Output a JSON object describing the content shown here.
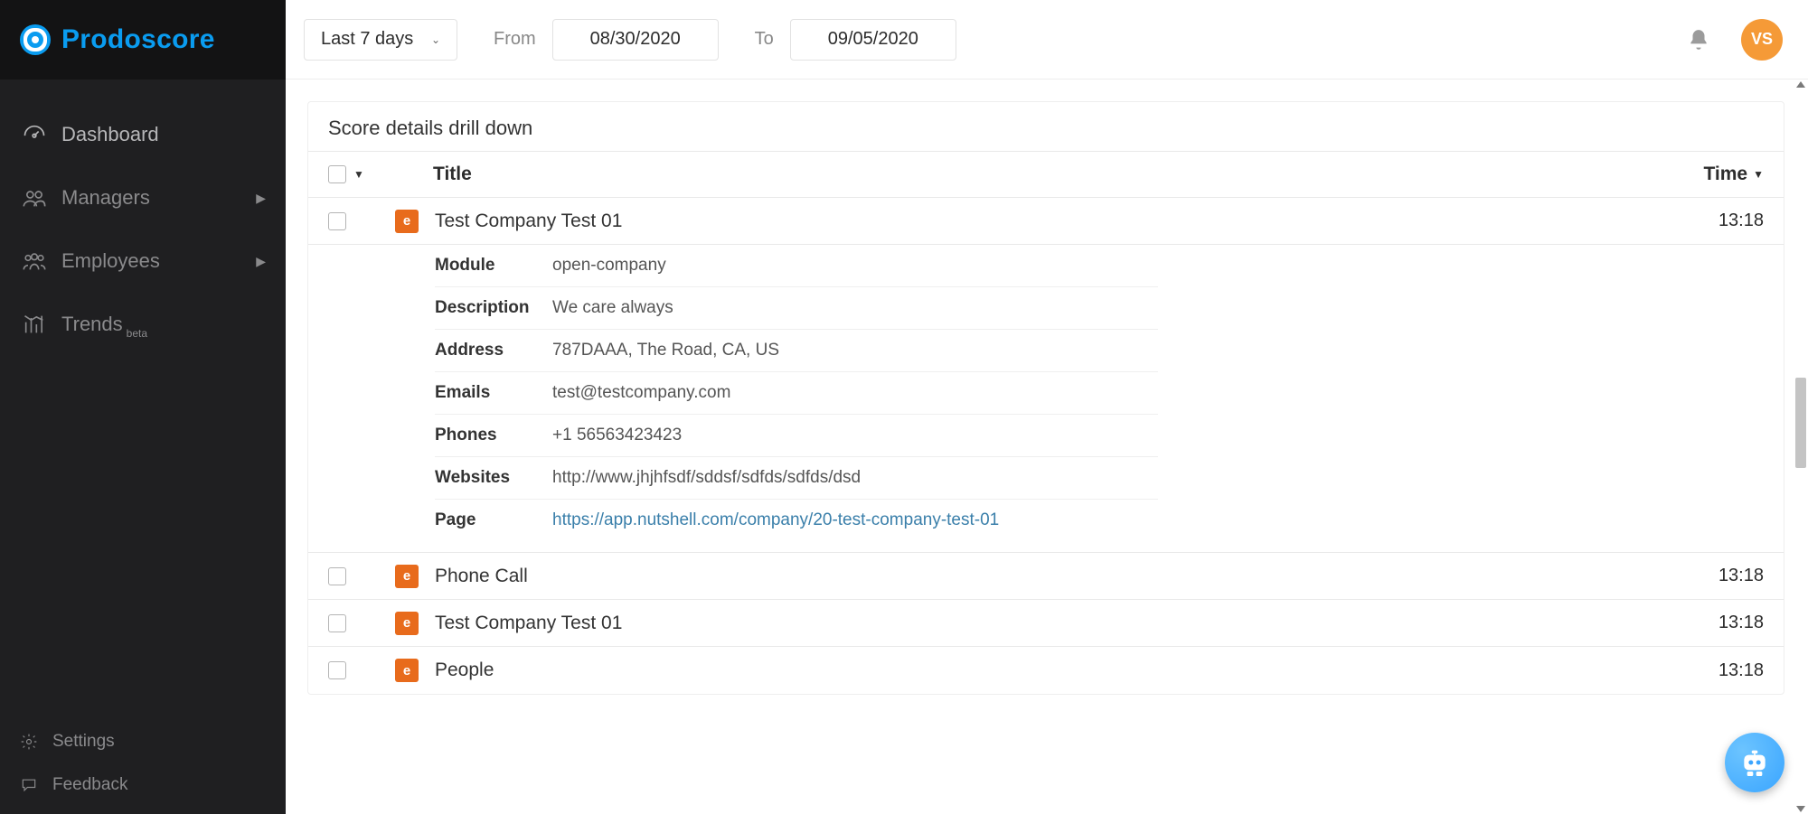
{
  "brand": {
    "name": "Prodoscore"
  },
  "sidebar": {
    "items": [
      {
        "label": "Dashboard"
      },
      {
        "label": "Managers"
      },
      {
        "label": "Employees"
      },
      {
        "label": "Trends",
        "badge": "beta"
      }
    ],
    "footer": [
      {
        "label": "Settings"
      },
      {
        "label": "Feedback"
      }
    ]
  },
  "topbar": {
    "range_label": "Last 7 days",
    "from_label": "From",
    "from_value": "08/30/2020",
    "to_label": "To",
    "to_value": "09/05/2020",
    "avatar_initials": "VS"
  },
  "panel": {
    "title": "Score details drill down",
    "columns": {
      "title": "Title",
      "time": "Time"
    },
    "rows": [
      {
        "title": "Test Company Test 01",
        "time": "13:18",
        "expanded": true,
        "details": [
          {
            "label": "Module",
            "value": "open-company"
          },
          {
            "label": "Description",
            "value": "We care always"
          },
          {
            "label": "Address",
            "value": "787DAAA, The Road, CA, US"
          },
          {
            "label": "Emails",
            "value": "test@testcompany.com"
          },
          {
            "label": "Phones",
            "value": "+1 56563423423"
          },
          {
            "label": "Websites",
            "value": "http://www.jhjhfsdf/sddsf/sdfds/sdfds/dsd"
          },
          {
            "label": "Page",
            "value": "https://app.nutshell.com/company/20-test-company-test-01",
            "link": true
          }
        ]
      },
      {
        "title": "Phone Call",
        "time": "13:18"
      },
      {
        "title": "Test Company Test 01",
        "time": "13:18"
      },
      {
        "title": "People",
        "time": "13:18"
      }
    ]
  }
}
